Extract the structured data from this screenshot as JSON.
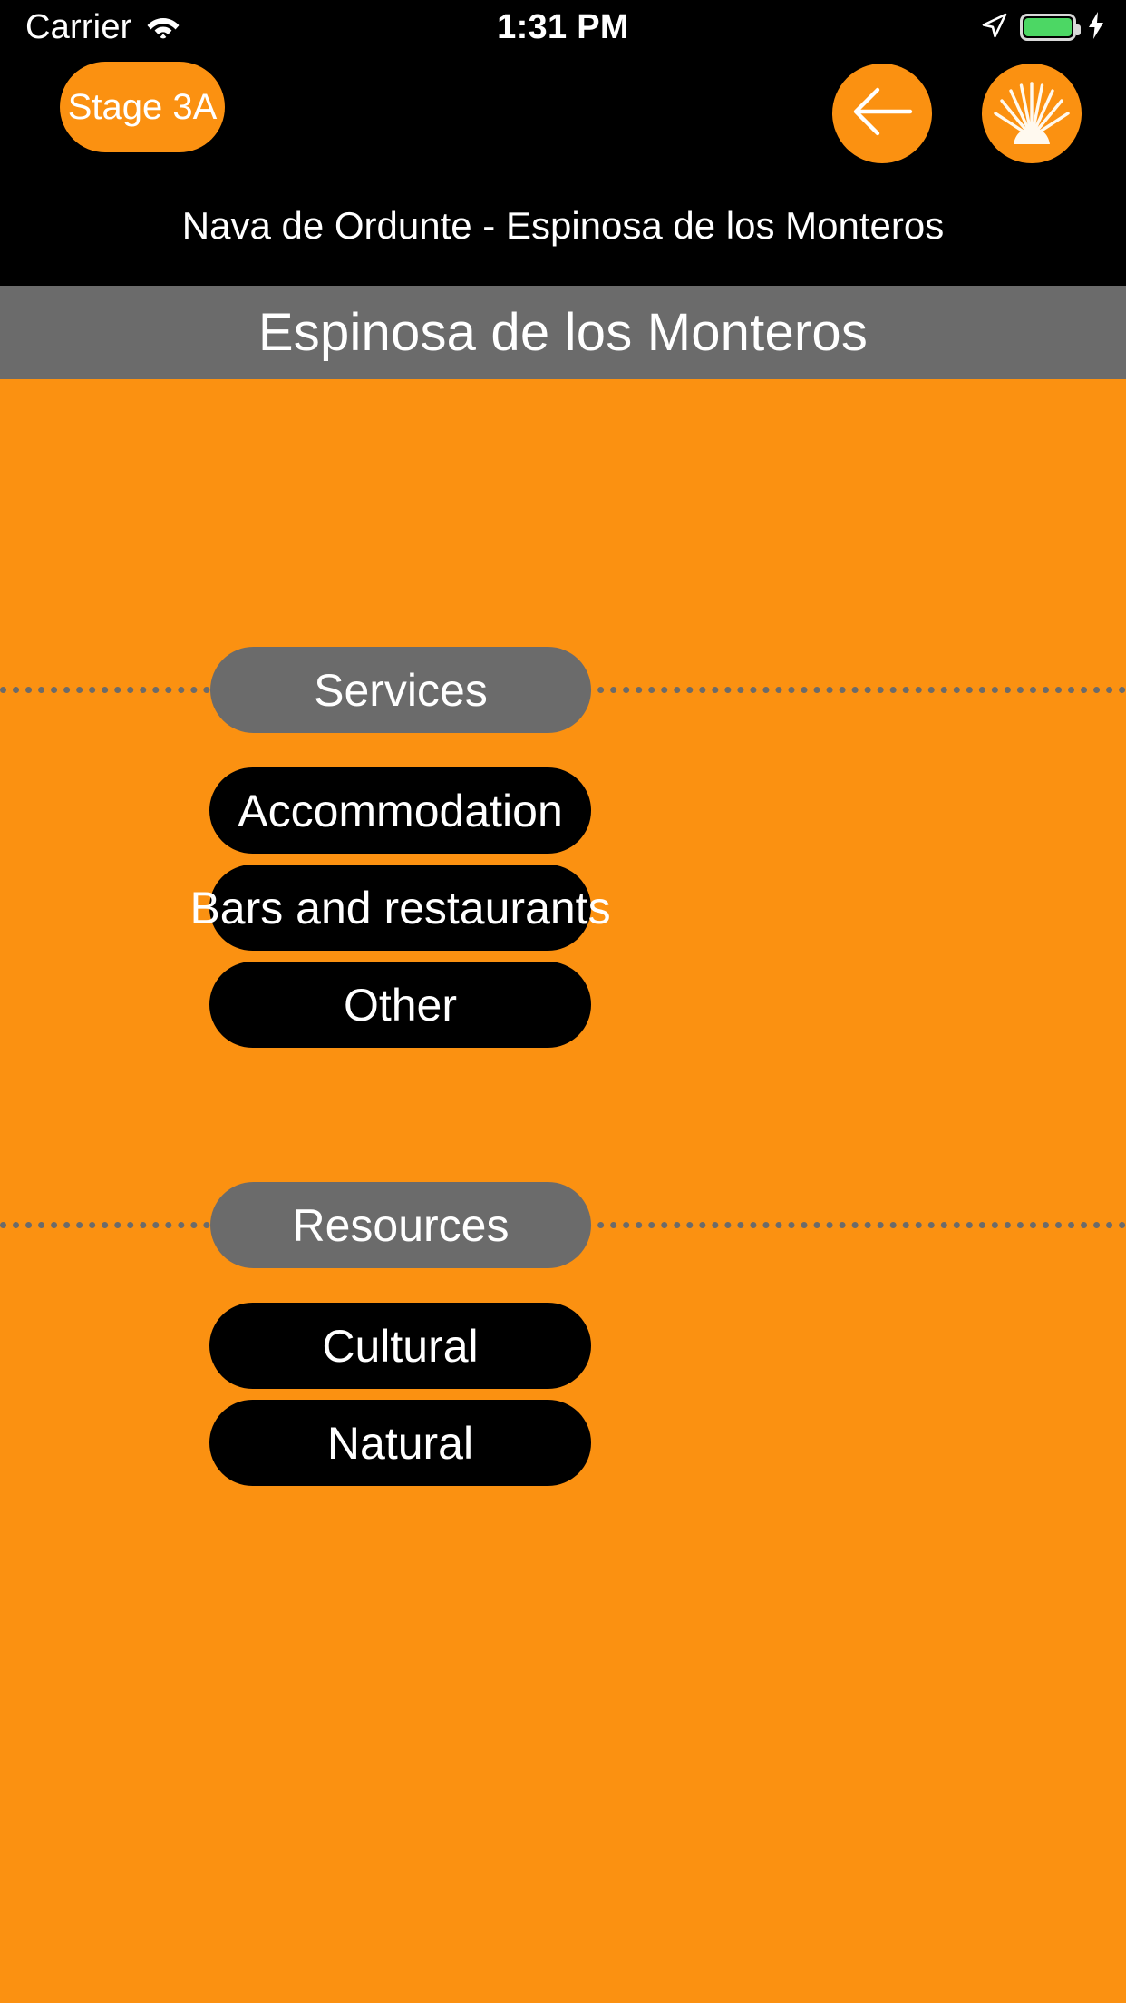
{
  "status_bar": {
    "carrier": "Carrier",
    "time": "1:31 PM",
    "wifi_icon": "wifi-icon",
    "location_icon": "location-arrow-icon",
    "battery_icon": "battery-icon",
    "charging_icon": "lightning-bolt-icon"
  },
  "nav": {
    "stage_label": "Stage 3A",
    "back_icon": "back-arrow-icon",
    "shell_icon": "scallop-shell-icon",
    "route_subtitle": "Nava de Ordunte - Espinosa de los Monteros"
  },
  "place_bar": {
    "title": "Espinosa de los Monteros"
  },
  "sections": [
    {
      "heading": "Services",
      "items": [
        {
          "label": "Accommodation"
        },
        {
          "label": "Bars and restaurants"
        },
        {
          "label": "Other"
        }
      ]
    },
    {
      "heading": "Resources",
      "items": [
        {
          "label": "Cultural"
        },
        {
          "label": "Natural"
        }
      ]
    }
  ],
  "colors": {
    "brand_orange": "#fb9111",
    "section_gray": "#6b6b6b",
    "item_black": "#000000",
    "text_white": "#ffffff",
    "battery_green": "#4cd764"
  }
}
